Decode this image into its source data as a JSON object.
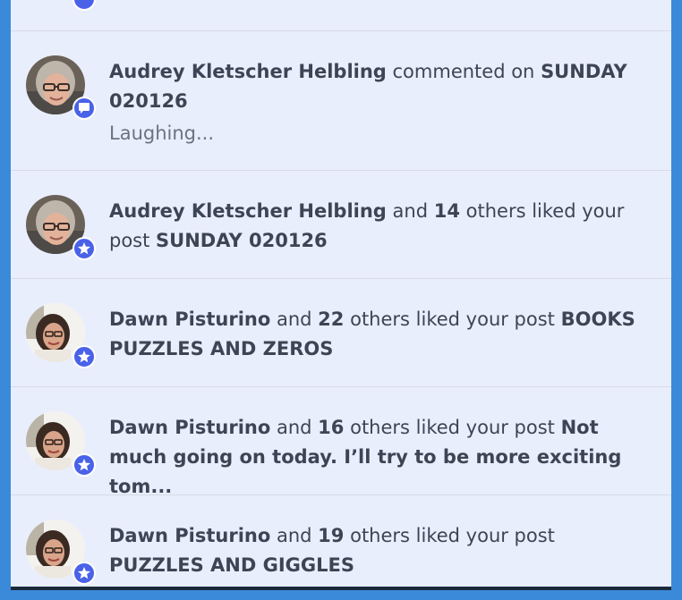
{
  "colors": {
    "page_background": "#3b8ad9",
    "panel_background": "#e9eefd",
    "badge": "#4a62e8",
    "text": "#3d4555",
    "muted_text": "#6b7280"
  },
  "notifications": [
    {
      "type": "comment",
      "badge_icon": "comment-icon",
      "actor": "Audrey Kletscher Helbling",
      "action": "commented on",
      "post": "SUNDAY 020126",
      "snippet": "Laughing..."
    },
    {
      "type": "like",
      "badge_icon": "star-icon",
      "actor": "Audrey Kletscher Helbling",
      "connector": "and",
      "count": "14",
      "action": "others liked your post",
      "post": "SUNDAY 020126"
    },
    {
      "type": "like",
      "badge_icon": "star-icon",
      "actor": "Dawn Pisturino",
      "connector": "and",
      "count": "22",
      "action": "others liked your post",
      "post": "BOOKS PUZZLES AND ZEROS"
    },
    {
      "type": "like",
      "badge_icon": "star-icon",
      "actor": "Dawn Pisturino",
      "connector": "and",
      "count": "16",
      "action": "others liked your post",
      "post": "Not much going on today. I’ll try to be more exciting tom..."
    },
    {
      "type": "like",
      "badge_icon": "star-icon",
      "actor": "Dawn Pisturino",
      "connector": "and",
      "count": "19",
      "action": "others liked your post",
      "post": "PUZZLES AND GIGGLES"
    }
  ]
}
